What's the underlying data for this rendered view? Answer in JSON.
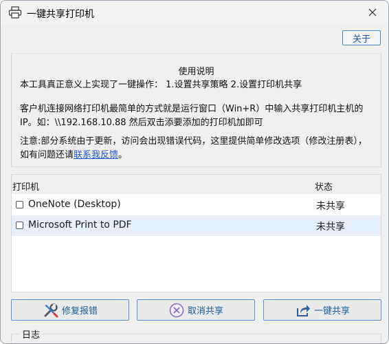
{
  "window": {
    "title": "一键共享打印机",
    "title_icon": "printer-icon",
    "close_icon": "close-icon"
  },
  "toolbar": {
    "about_label": "关于"
  },
  "usage": {
    "title": "使用说明",
    "line1": "本工具真正意义上实现了一键操作： 1.设置共享策略 2.设置打印机共享",
    "line2": "客户机连接网络打印机最简单的方式就是运行窗口（Win+R）中输入共享打印机主机的IP。如：\\\\192.168.10.88 然后双击添要添加的打印机加即可",
    "line3_prefix": "注意:部分系统由于更新，访问会出现错误代码，这里提供简单修改选项（修改注册表），如有问题还请",
    "line3_link": "联系我反馈",
    "line3_suffix": "。"
  },
  "printer_table": {
    "columns": [
      "打印机",
      "状态"
    ],
    "rows": [
      {
        "name": "OneNote (Desktop)",
        "status": "未共享",
        "checked": false,
        "selected": false
      },
      {
        "name": "Microsoft Print to PDF",
        "status": "未共享",
        "checked": false,
        "selected": true
      }
    ]
  },
  "actions": {
    "repair_label": "修复报错",
    "repair_icon": "wrench-screwdriver-icon",
    "cancel_share_label": "取消共享",
    "cancel_share_icon": "cancel-circle-icon",
    "share_label": "一键共享",
    "share_icon": "share-arrow-icon"
  },
  "log": {
    "label": "日志"
  },
  "colors": {
    "accent_border": "#5a8fd1",
    "link": "#1a56d6",
    "selected_row": "#e6f0fb",
    "window_bg": "#f0f0f0"
  }
}
